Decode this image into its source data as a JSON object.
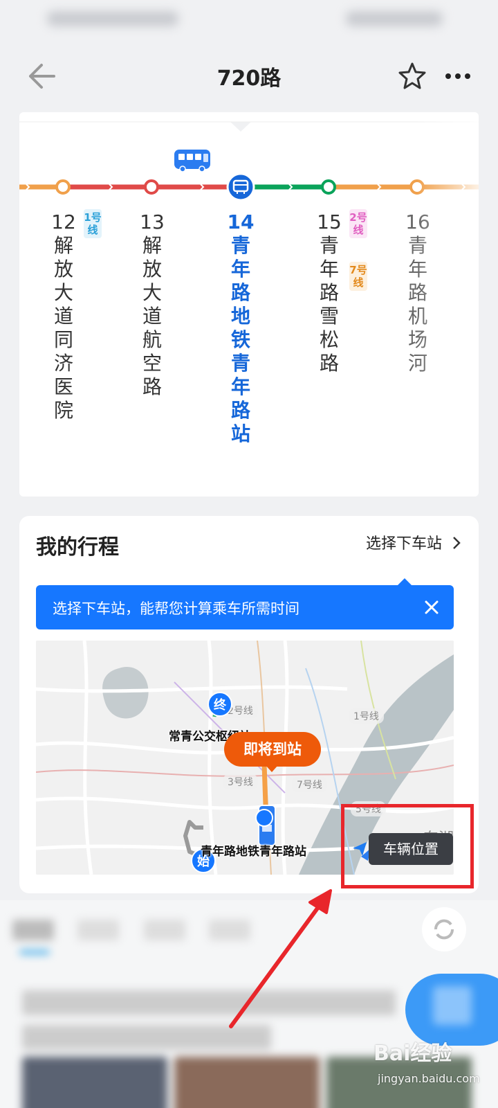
{
  "header": {
    "title": "720路",
    "back_icon": "arrow-left-icon",
    "favorite_icon": "star-icon",
    "more_icon": "more-dots-icon"
  },
  "route": {
    "stops": [
      {
        "num": "12",
        "name": "解放大道同济医院",
        "state": "passed"
      },
      {
        "num": "13",
        "name": "解放大道航空路",
        "state": "passed"
      },
      {
        "num": "14",
        "name": "青年路地铁青年路站",
        "state": "current"
      },
      {
        "num": "15",
        "name": "青年路雪松路",
        "state": "upcoming"
      },
      {
        "num": "16",
        "name": "青年路机场河",
        "state": "upcoming"
      }
    ],
    "transfer_tags": [
      {
        "text": "1号线",
        "after_stop": "12",
        "color": "#2aa0d8"
      },
      {
        "text": "2号线",
        "after_stop": "15",
        "color": "#e05ec0"
      },
      {
        "text": "7号线",
        "after_stop": "15",
        "color": "#e38a1d"
      }
    ],
    "colors": {
      "slow": "#e04a48",
      "smooth": "#0aa35a",
      "unknown": "#f0a04b",
      "accent": "#1667d9"
    }
  },
  "trip": {
    "title": "我的行程",
    "select_stop_label": "选择下车站",
    "tip_text": "选择下车站，能帮您计算乘车所需时间",
    "map": {
      "end_pin": "终",
      "start_pin": "始",
      "end_station": "常青公交枢纽站",
      "current_station": "青年路地铁青年路站",
      "arrive_bubble": "即将到站",
      "line_labels": [
        "1号线",
        "2号线",
        "3号线",
        "7号线",
        "5号线"
      ],
      "district": "东湖"
    },
    "vehicle_position_label": "车辆位置"
  },
  "watermark": {
    "main": "Bai经验",
    "sub": "jingyan.baidu.com"
  }
}
